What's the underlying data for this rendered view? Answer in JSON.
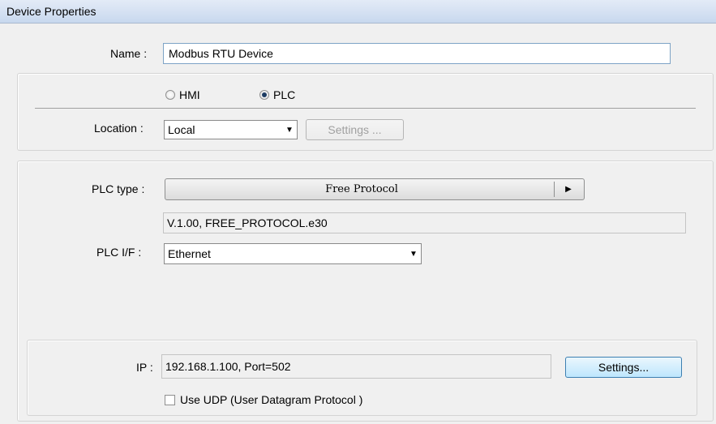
{
  "window": {
    "title": "Device Properties"
  },
  "name": {
    "label": "Name :",
    "value": "Modbus RTU Device"
  },
  "role": {
    "options": [
      {
        "label": "HMI",
        "checked": false
      },
      {
        "label": "PLC",
        "checked": true
      }
    ]
  },
  "location": {
    "label": "Location :",
    "value": "Local",
    "settings_label": "Settings ..."
  },
  "plc": {
    "type_label": "PLC type :",
    "type_value": "Free Protocol",
    "version_text": "V.1.00, FREE_PROTOCOL.e30",
    "if_label": "PLC I/F :",
    "if_value": "Ethernet"
  },
  "ip": {
    "label": "IP :",
    "value": "192.168.1.100,  Port=502",
    "settings_label": "Settings...",
    "udp_label": "Use UDP (User Datagram Protocol )",
    "udp_checked": false
  }
}
